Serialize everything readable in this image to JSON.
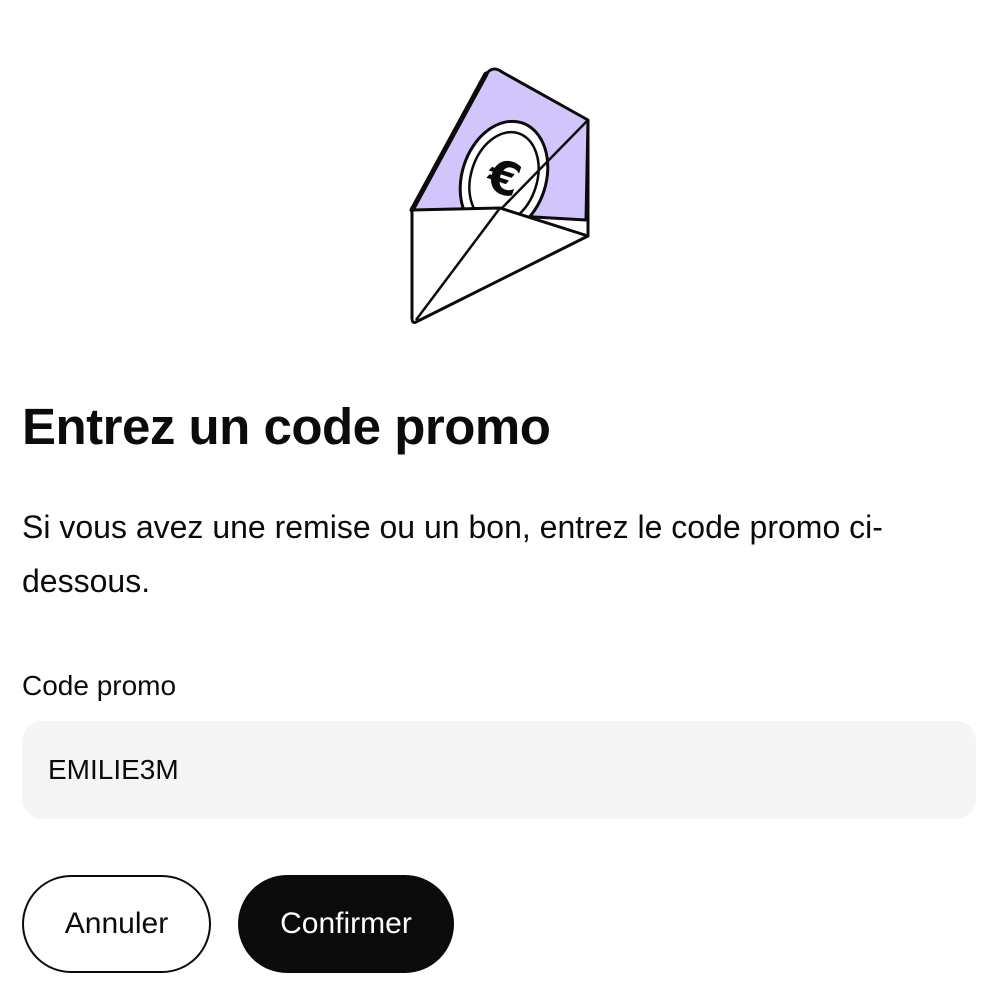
{
  "illustration": {
    "icon": "envelope-euro-coin-icon",
    "coin_symbol": "€",
    "accent_color": "#d2c5fb"
  },
  "dialog": {
    "title": "Entrez un code promo",
    "description": "Si vous avez une remise ou un bon, entrez le code promo ci-dessous.",
    "field_label": "Code promo",
    "field_value": "EMILIE3M",
    "cancel_label": "Annuler",
    "confirm_label": "Confirmer"
  }
}
